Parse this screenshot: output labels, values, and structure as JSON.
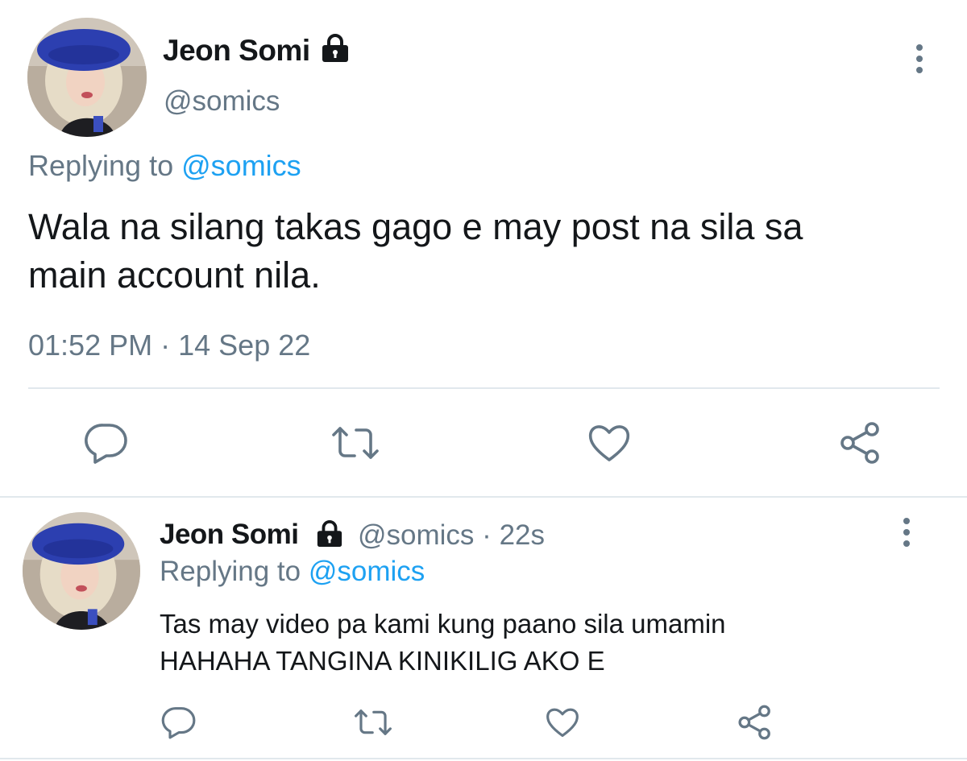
{
  "main_tweet": {
    "display_name": "Jeon Somi",
    "handle": "@somics",
    "replying_prefix": "Replying to",
    "replying_handle": "@somics",
    "text_line1": "Wala na silang takas gago e may post na sila sa",
    "text_line2": "main account nila.",
    "time": "01:52 PM",
    "separator": "·",
    "date": "14 Sep 22",
    "icons": [
      "lock-icon",
      "more-vertical-icon",
      "reply-icon",
      "retweet-icon",
      "like-icon",
      "share-icon"
    ]
  },
  "reply_tweet": {
    "display_name": "Jeon Somi",
    "handle": "@somics",
    "separator": "·",
    "age": "22s",
    "replying_prefix": "Replying to",
    "replying_handle": "@somics",
    "text_line1": "Tas may video pa kami kung paano sila umamin",
    "text_line2": "HAHAHA TANGINA KINIKILIG AKO E",
    "icons": [
      "lock-icon",
      "more-vertical-icon",
      "reply-icon",
      "retweet-icon",
      "like-icon",
      "share-icon"
    ]
  },
  "colors": {
    "link": "#1da1f2",
    "secondary_text": "#657786",
    "primary_text": "#14171a",
    "icon": "#657786",
    "divider": "#e1e8ed",
    "avatar_hat": "#2c3fb0"
  }
}
